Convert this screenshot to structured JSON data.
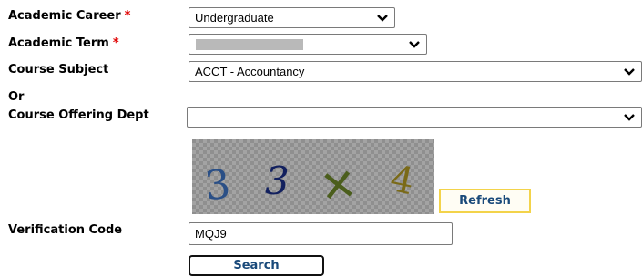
{
  "form": {
    "academic_career": {
      "label": "Academic Career",
      "required_mark": "*",
      "value": "Undergraduate"
    },
    "academic_term": {
      "label": "Academic Term",
      "required_mark": "*",
      "value": ""
    },
    "course_subject": {
      "label": "Course Subject",
      "value": "ACCT - Accountancy"
    },
    "or_label": "Or",
    "course_offering_dept": {
      "label": "Course Offering Dept",
      "value": ""
    },
    "captcha": {
      "chars": [
        "3",
        "3",
        "+",
        "4"
      ]
    },
    "refresh_label": "Refresh",
    "verification_code": {
      "label": "Verification Code",
      "value": "MQJ9"
    },
    "search_label": "Search"
  },
  "colors": {
    "required": "#e00000",
    "button_text": "#1a4a7a",
    "refresh_border": "#f3d34a",
    "captcha_char_1": "#2a4f86",
    "captcha_char_2": "#12205e",
    "captcha_char_3": "#4b5e1c",
    "captcha_char_4": "#7a6a18"
  },
  "icons": {
    "dropdown": "chevron-down-icon"
  }
}
